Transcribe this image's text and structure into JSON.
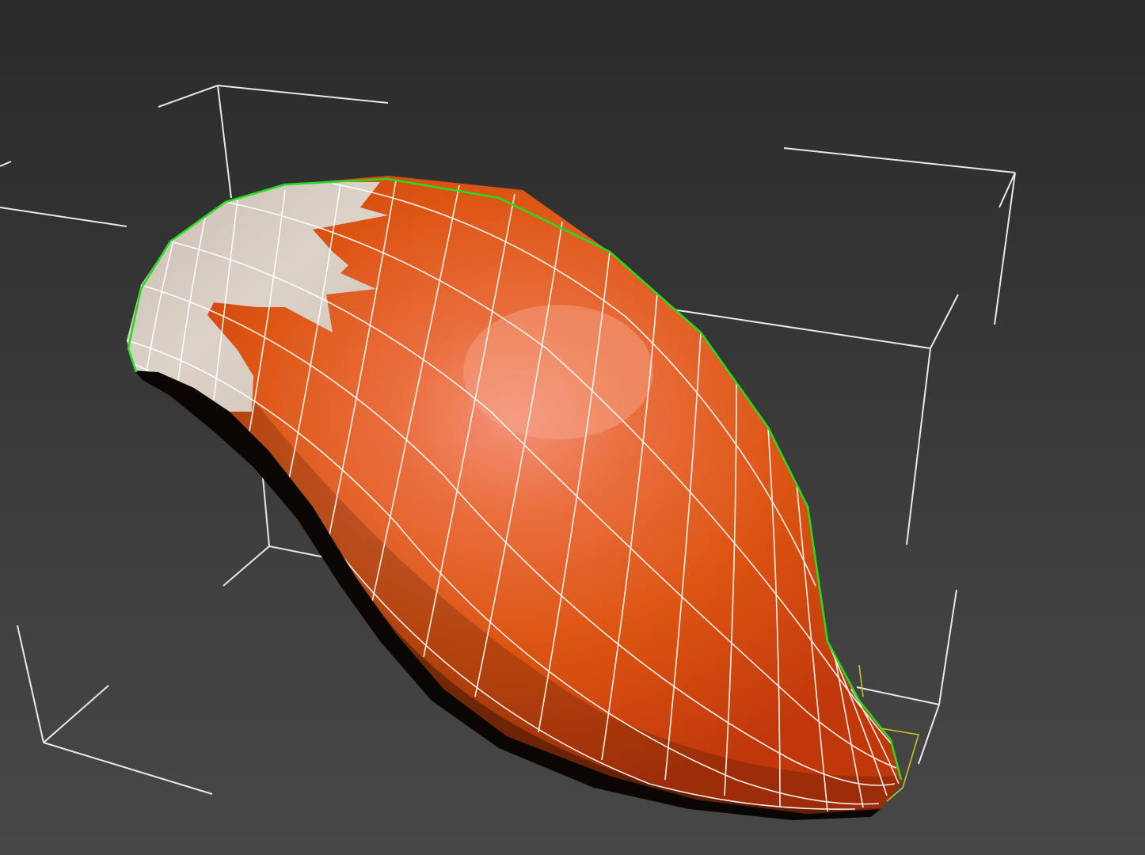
{
  "viewport": {
    "background_top": "#2b2b2b",
    "background_bottom": "#474747"
  },
  "object": {
    "name": "",
    "kind": "subdivided tail mesh (selected)",
    "base_color": "#e05a14",
    "highlight_color": "#f29070",
    "tip_color": "#d8cdc2",
    "wireframe_color": "#ffffff",
    "selected_edge_color": "#22dd22"
  },
  "bounding_box": {
    "color": "#e8e8e8"
  },
  "pivot_gizmo": {
    "color": "#c8c020"
  }
}
